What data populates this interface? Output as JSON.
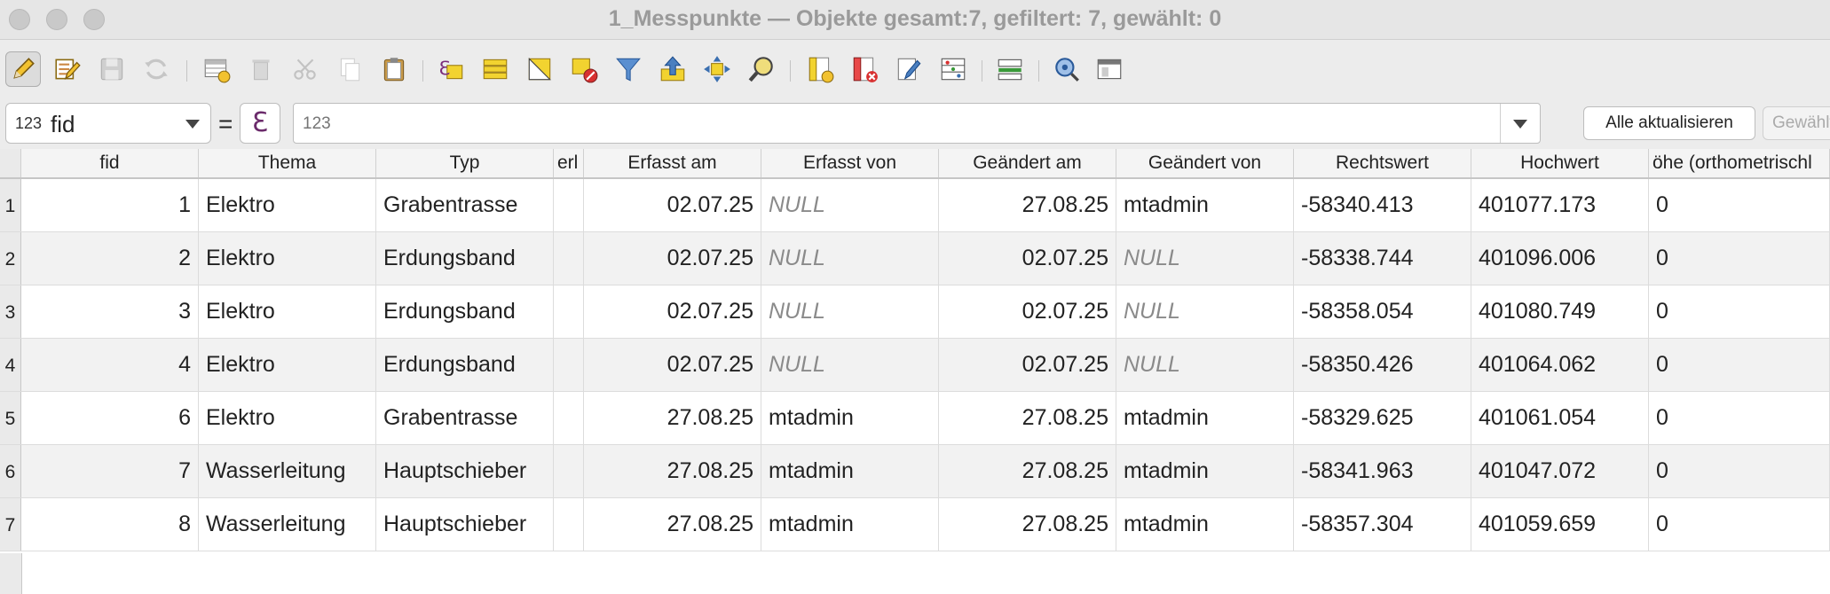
{
  "window": {
    "title": "1_Messpunkte — Objekte gesamt:7, gefiltert: 7, gewählt: 0"
  },
  "toolbar": {
    "icons": [
      "pencil-icon",
      "multi-edit-icon",
      "save-icon",
      "reload-icon",
      "add-feature-icon",
      "delete-icon",
      "cut-icon",
      "copy-icon",
      "paste-icon",
      "expression-select-icon",
      "select-all-icon",
      "invert-selection-icon",
      "deselect-icon",
      "filter-icon",
      "move-selection-top-icon",
      "pan-to-selection-icon",
      "zoom-to-selection-icon",
      "new-field-icon",
      "delete-field-icon",
      "field-calculator-icon",
      "conditional-formatting-icon",
      "dock-icon",
      "actions-icon",
      "form-view-icon"
    ]
  },
  "filter": {
    "field_prefix": "123",
    "field_name": "fid",
    "equals": "=",
    "epsilon": "ℇ",
    "value_placeholder": "123",
    "update_all_label": "Alle aktualisieren",
    "update_selected_label": "Gewählte aktualisieren"
  },
  "table": {
    "columns": [
      "fid",
      "Thema",
      "Typ",
      "erl",
      "Erfasst am",
      "Erfasst von",
      "Geändert am",
      "Geändert von",
      "Rechtswert",
      "Hochwert",
      "öhe (orthometrischl"
    ],
    "rows": [
      {
        "num": "1",
        "fid": "1",
        "thema": "Elektro",
        "typ": "Grabentrasse",
        "erl": "",
        "erfasst_am": "02.07.25",
        "erfasst_von": "NULL",
        "geaendert_am": "27.08.25",
        "geaendert_von": "mtadmin",
        "rechtswert": "-58340.413",
        "hochwert": "401077.173",
        "hoehe": "0"
      },
      {
        "num": "2",
        "fid": "2",
        "thema": "Elektro",
        "typ": "Erdungsband",
        "erl": "",
        "erfasst_am": "02.07.25",
        "erfasst_von": "NULL",
        "geaendert_am": "02.07.25",
        "geaendert_von": "NULL",
        "rechtswert": "-58338.744",
        "hochwert": "401096.006",
        "hoehe": "0"
      },
      {
        "num": "3",
        "fid": "3",
        "thema": "Elektro",
        "typ": "Erdungsband",
        "erl": "",
        "erfasst_am": "02.07.25",
        "erfasst_von": "NULL",
        "geaendert_am": "02.07.25",
        "geaendert_von": "NULL",
        "rechtswert": "-58358.054",
        "hochwert": "401080.749",
        "hoehe": "0"
      },
      {
        "num": "4",
        "fid": "4",
        "thema": "Elektro",
        "typ": "Erdungsband",
        "erl": "",
        "erfasst_am": "02.07.25",
        "erfasst_von": "NULL",
        "geaendert_am": "02.07.25",
        "geaendert_von": "NULL",
        "rechtswert": "-58350.426",
        "hochwert": "401064.062",
        "hoehe": "0"
      },
      {
        "num": "5",
        "fid": "6",
        "thema": "Elektro",
        "typ": "Grabentrasse",
        "erl": "",
        "erfasst_am": "27.08.25",
        "erfasst_von": "mtadmin",
        "geaendert_am": "27.08.25",
        "geaendert_von": "mtadmin",
        "rechtswert": "-58329.625",
        "hochwert": "401061.054",
        "hoehe": "0"
      },
      {
        "num": "6",
        "fid": "7",
        "thema": "Wasserleitung",
        "typ": "Hauptschieber",
        "erl": "",
        "erfasst_am": "27.08.25",
        "erfasst_von": "mtadmin",
        "geaendert_am": "27.08.25",
        "geaendert_von": "mtadmin",
        "rechtswert": "-58341.963",
        "hochwert": "401047.072",
        "hoehe": "0"
      },
      {
        "num": "7",
        "fid": "8",
        "thema": "Wasserleitung",
        "typ": "Hauptschieber",
        "erl": "",
        "erfasst_am": "27.08.25",
        "erfasst_von": "mtadmin",
        "geaendert_am": "27.08.25",
        "geaendert_von": "mtadmin",
        "rechtswert": "-58357.304",
        "hochwert": "401059.659",
        "hoehe": "0"
      }
    ]
  }
}
